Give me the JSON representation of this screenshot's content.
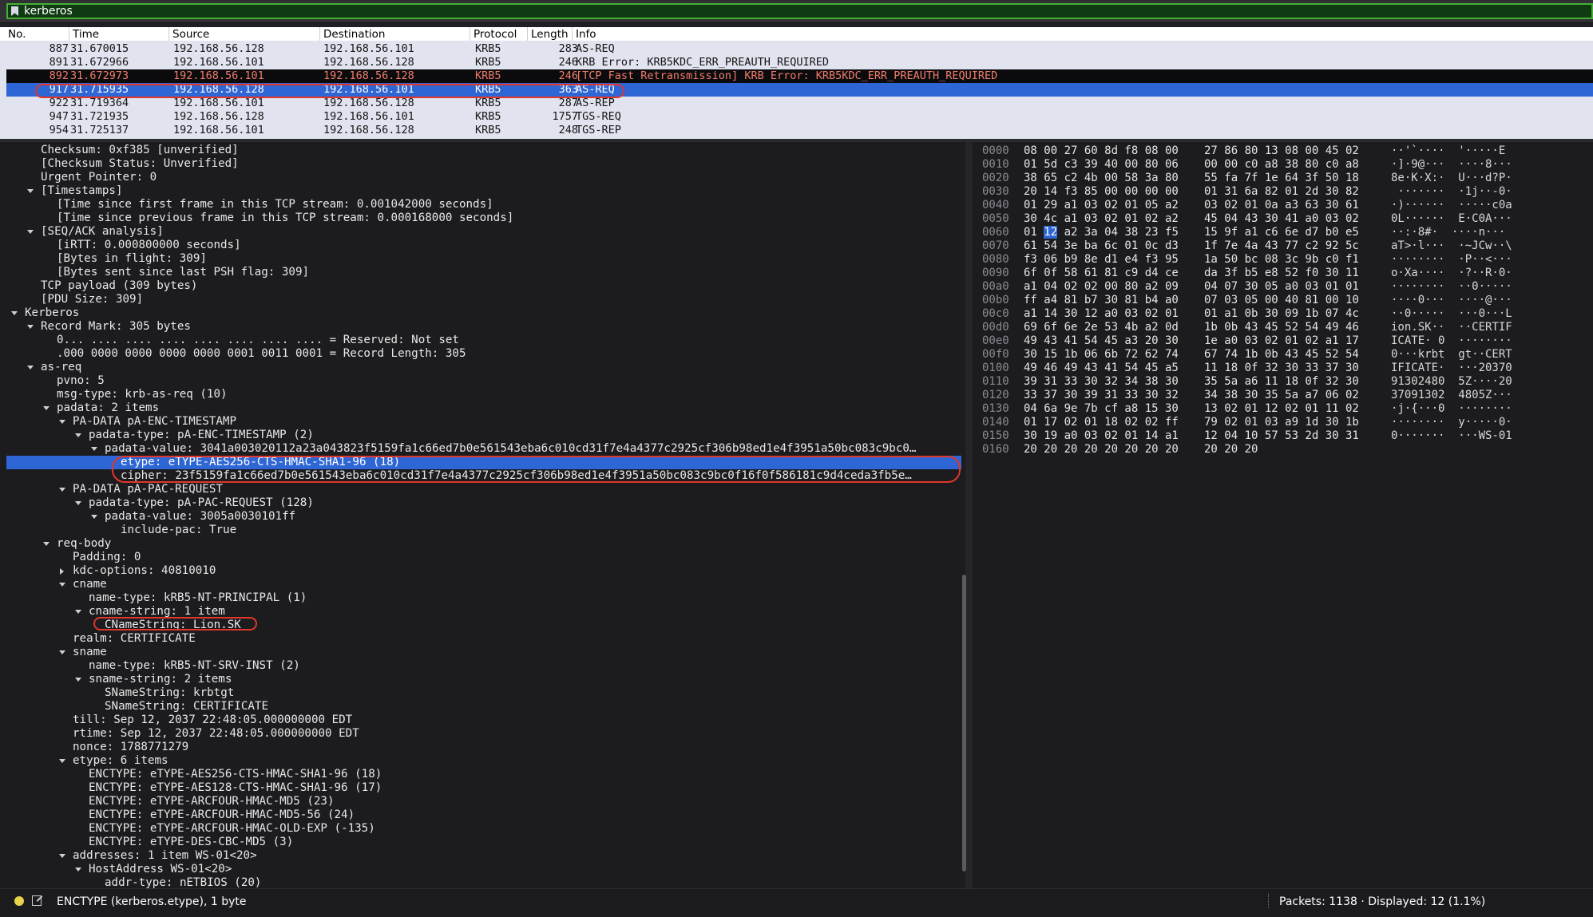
{
  "filter": {
    "value": "kerberos"
  },
  "packet_list": {
    "columns": [
      "No.",
      "Time",
      "Source",
      "Destination",
      "Protocol",
      "Length",
      "Info"
    ],
    "rows": [
      {
        "no": "887",
        "time": "31.670015",
        "src": "192.168.56.128",
        "dst": "192.168.56.101",
        "proto": "KRB5",
        "len": "283",
        "info": "AS-REQ",
        "style": "normal"
      },
      {
        "no": "891",
        "time": "31.672966",
        "src": "192.168.56.101",
        "dst": "192.168.56.128",
        "proto": "KRB5",
        "len": "246",
        "info": "KRB Error: KRB5KDC_ERR_PREAUTH_REQUIRED",
        "style": "normal"
      },
      {
        "no": "892",
        "time": "31.672973",
        "src": "192.168.56.101",
        "dst": "192.168.56.128",
        "proto": "KRB5",
        "len": "246",
        "info": "[TCP Fast Retransmission] KRB Error: KRB5KDC_ERR_PREAUTH_REQUIRED",
        "style": "bad"
      },
      {
        "no": "917",
        "time": "31.715935",
        "src": "192.168.56.128",
        "dst": "192.168.56.101",
        "proto": "KRB5",
        "len": "363",
        "info": "AS-REQ",
        "style": "selected"
      },
      {
        "no": "922",
        "time": "31.719364",
        "src": "192.168.56.101",
        "dst": "192.168.56.128",
        "proto": "KRB5",
        "len": "287",
        "info": "AS-REP",
        "style": "normal"
      },
      {
        "no": "947",
        "time": "31.721935",
        "src": "192.168.56.128",
        "dst": "192.168.56.101",
        "proto": "KRB5",
        "len": "1757",
        "info": "TGS-REQ",
        "style": "normal"
      },
      {
        "no": "954",
        "time": "31.725137",
        "src": "192.168.56.101",
        "dst": "192.168.56.128",
        "proto": "KRB5",
        "len": "248",
        "info": "TGS-REP",
        "style": "normal"
      }
    ]
  },
  "details": {
    "lines": [
      {
        "indent": 2,
        "arrow": "",
        "text": "Checksum: 0xf385 [unverified]"
      },
      {
        "indent": 2,
        "arrow": "",
        "text": "[Checksum Status: Unverified]"
      },
      {
        "indent": 2,
        "arrow": "",
        "text": "Urgent Pointer: 0"
      },
      {
        "indent": 2,
        "arrow": "down",
        "text": "[Timestamps]"
      },
      {
        "indent": 3,
        "arrow": "",
        "text": "[Time since first frame in this TCP stream: 0.001042000 seconds]"
      },
      {
        "indent": 3,
        "arrow": "",
        "text": "[Time since previous frame in this TCP stream: 0.000168000 seconds]"
      },
      {
        "indent": 2,
        "arrow": "down",
        "text": "[SEQ/ACK analysis]"
      },
      {
        "indent": 3,
        "arrow": "",
        "text": "[iRTT: 0.000800000 seconds]"
      },
      {
        "indent": 3,
        "arrow": "",
        "text": "[Bytes in flight: 309]"
      },
      {
        "indent": 3,
        "arrow": "",
        "text": "[Bytes sent since last PSH flag: 309]"
      },
      {
        "indent": 2,
        "arrow": "",
        "text": "TCP payload (309 bytes)"
      },
      {
        "indent": 2,
        "arrow": "",
        "text": "[PDU Size: 309]"
      },
      {
        "indent": 1,
        "arrow": "down",
        "text": "Kerberos"
      },
      {
        "indent": 2,
        "arrow": "down",
        "text": "Record Mark: 305 bytes"
      },
      {
        "indent": 3,
        "arrow": "",
        "text": "0... .... .... .... .... .... .... .... = Reserved: Not set"
      },
      {
        "indent": 3,
        "arrow": "",
        "text": ".000 0000 0000 0000 0000 0001 0011 0001 = Record Length: 305"
      },
      {
        "indent": 2,
        "arrow": "down",
        "text": "as-req"
      },
      {
        "indent": 3,
        "arrow": "",
        "text": "pvno: 5"
      },
      {
        "indent": 3,
        "arrow": "",
        "text": "msg-type: krb-as-req (10)"
      },
      {
        "indent": 3,
        "arrow": "down",
        "text": "padata: 2 items"
      },
      {
        "indent": 4,
        "arrow": "down",
        "text": "PA-DATA pA-ENC-TIMESTAMP"
      },
      {
        "indent": 5,
        "arrow": "down",
        "text": "padata-type: pA-ENC-TIMESTAMP (2)"
      },
      {
        "indent": 6,
        "arrow": "down",
        "text": "padata-value: 3041a003020112a23a043823f5159fa1c66ed7b0e561543eba6c010cd31f7e4a4377c2925cf306b98ed1e4f3951a50bc083c9bc0…"
      },
      {
        "indent": 7,
        "arrow": "",
        "text": "etype: eTYPE-AES256-CTS-HMAC-SHA1-96 (18)",
        "selected": true
      },
      {
        "indent": 7,
        "arrow": "",
        "text": "cipher: 23f5159fa1c66ed7b0e561543eba6c010cd31f7e4a4377c2925cf306b98ed1e4f3951a50bc083c9bc0f16f0f586181c9d4ceda3fb5e…"
      },
      {
        "indent": 4,
        "arrow": "down",
        "text": "PA-DATA pA-PAC-REQUEST"
      },
      {
        "indent": 5,
        "arrow": "down",
        "text": "padata-type: pA-PAC-REQUEST (128)"
      },
      {
        "indent": 6,
        "arrow": "down",
        "text": "padata-value: 3005a0030101ff"
      },
      {
        "indent": 7,
        "arrow": "",
        "text": "include-pac: True"
      },
      {
        "indent": 3,
        "arrow": "down",
        "text": "req-body"
      },
      {
        "indent": 4,
        "arrow": "",
        "text": "Padding: 0"
      },
      {
        "indent": 4,
        "arrow": "right",
        "text": "kdc-options: 40810010"
      },
      {
        "indent": 4,
        "arrow": "down",
        "text": "cname"
      },
      {
        "indent": 5,
        "arrow": "",
        "text": "name-type: kRB5-NT-PRINCIPAL (1)"
      },
      {
        "indent": 5,
        "arrow": "down",
        "text": "cname-string: 1 item"
      },
      {
        "indent": 6,
        "arrow": "",
        "text": "CNameString: Lion.SK"
      },
      {
        "indent": 4,
        "arrow": "",
        "text": "realm: CERTIFICATE"
      },
      {
        "indent": 4,
        "arrow": "down",
        "text": "sname"
      },
      {
        "indent": 5,
        "arrow": "",
        "text": "name-type: kRB5-NT-SRV-INST (2)"
      },
      {
        "indent": 5,
        "arrow": "down",
        "text": "sname-string: 2 items"
      },
      {
        "indent": 6,
        "arrow": "",
        "text": "SNameString: krbtgt"
      },
      {
        "indent": 6,
        "arrow": "",
        "text": "SNameString: CERTIFICATE"
      },
      {
        "indent": 4,
        "arrow": "",
        "text": "till: Sep 12, 2037 22:48:05.000000000 EDT"
      },
      {
        "indent": 4,
        "arrow": "",
        "text": "rtime: Sep 12, 2037 22:48:05.000000000 EDT"
      },
      {
        "indent": 4,
        "arrow": "",
        "text": "nonce: 1788771279"
      },
      {
        "indent": 4,
        "arrow": "down",
        "text": "etype: 6 items"
      },
      {
        "indent": 5,
        "arrow": "",
        "text": "ENCTYPE: eTYPE-AES256-CTS-HMAC-SHA1-96 (18)"
      },
      {
        "indent": 5,
        "arrow": "",
        "text": "ENCTYPE: eTYPE-AES128-CTS-HMAC-SHA1-96 (17)"
      },
      {
        "indent": 5,
        "arrow": "",
        "text": "ENCTYPE: eTYPE-ARCFOUR-HMAC-MD5 (23)"
      },
      {
        "indent": 5,
        "arrow": "",
        "text": "ENCTYPE: eTYPE-ARCFOUR-HMAC-MD5-56 (24)"
      },
      {
        "indent": 5,
        "arrow": "",
        "text": "ENCTYPE: eTYPE-ARCFOUR-HMAC-OLD-EXP (-135)"
      },
      {
        "indent": 5,
        "arrow": "",
        "text": "ENCTYPE: eTYPE-DES-CBC-MD5 (3)"
      },
      {
        "indent": 4,
        "arrow": "down",
        "text": "addresses: 1 item WS-01<20>"
      },
      {
        "indent": 5,
        "arrow": "down",
        "text": "HostAddress WS-01<20>"
      },
      {
        "indent": 6,
        "arrow": "",
        "text": "addr-type: nETBIOS (20)"
      }
    ]
  },
  "bytes": {
    "rows": [
      {
        "off": "0000",
        "hex1": "08 00 27 60 8d f8 08 00",
        "hex2": "27 86 80 13 08 00 45 02",
        "ascii": "··'`····  '·····E"
      },
      {
        "off": "0010",
        "hex1": "01 5d c3 39 40 00 80 06",
        "hex2": "00 00 c0 a8 38 80 c0 a8",
        "ascii": "·]·9@···  ····8···"
      },
      {
        "off": "0020",
        "hex1": "38 65 c2 4b 00 58 3a 80",
        "hex2": "55 fa 7f 1e 64 3f 50 18",
        "ascii": "8e·K·X:·  U···d?P·"
      },
      {
        "off": "0030",
        "hex1": "20 14 f3 85 00 00 00 00",
        "hex2": "01 31 6a 82 01 2d 30 82",
        "ascii": " ·······  ·1j··-0·"
      },
      {
        "off": "0040",
        "hex1": "01 29 a1 03 02 01 05 a2",
        "hex2": "03 02 01 0a a3 63 30 61",
        "ascii": "·)······  ·····c0a"
      },
      {
        "off": "0050",
        "hex1": "30 4c a1 03 02 01 02 a2",
        "hex2": "45 04 43 30 41 a0 03 02",
        "ascii": "0L······  E·C0A···"
      },
      {
        "off": "0060",
        "hex1": "01 12 a2 3a 04 38 23 f5",
        "hex2": "15 9f a1 c6 6e d7 b0 e5",
        "ascii": "··:·8#·  ····n···"
      },
      {
        "off": "0070",
        "hex1": "61 54 3e ba 6c 01 0c d3",
        "hex2": "1f 7e 4a 43 77 c2 92 5c",
        "ascii": "aT>·l···  ·~JCw··\\"
      },
      {
        "off": "0080",
        "hex1": "f3 06 b9 8e d1 e4 f3 95",
        "hex2": "1a 50 bc 08 3c 9b c0 f1",
        "ascii": "········  ·P··<···"
      },
      {
        "off": "0090",
        "hex1": "6f 0f 58 61 81 c9 d4 ce",
        "hex2": "da 3f b5 e8 52 f0 30 11",
        "ascii": "o·Xa····  ·?··R·0·"
      },
      {
        "off": "00a0",
        "hex1": "a1 04 02 02 00 80 a2 09",
        "hex2": "04 07 30 05 a0 03 01 01",
        "ascii": "········  ··0·····"
      },
      {
        "off": "00b0",
        "hex1": "ff a4 81 b7 30 81 b4 a0",
        "hex2": "07 03 05 00 40 81 00 10",
        "ascii": "····0···  ····@···"
      },
      {
        "off": "00c0",
        "hex1": "a1 14 30 12 a0 03 02 01",
        "hex2": "01 a1 0b 30 09 1b 07 4c",
        "ascii": "··0·····  ···0···L"
      },
      {
        "off": "00d0",
        "hex1": "69 6f 6e 2e 53 4b a2 0d",
        "hex2": "1b 0b 43 45 52 54 49 46",
        "ascii": "ion.SK··  ··CERTIF"
      },
      {
        "off": "00e0",
        "hex1": "49 43 41 54 45 a3 20 30",
        "hex2": "1e a0 03 02 01 02 a1 17",
        "ascii": "ICATE· 0  ········"
      },
      {
        "off": "00f0",
        "hex1": "30 15 1b 06 6b 72 62 74",
        "hex2": "67 74 1b 0b 43 45 52 54",
        "ascii": "0···krbt  gt··CERT"
      },
      {
        "off": "0100",
        "hex1": "49 46 49 43 41 54 45 a5",
        "hex2": "11 18 0f 32 30 33 37 30",
        "ascii": "IFICATE·  ···20370"
      },
      {
        "off": "0110",
        "hex1": "39 31 33 30 32 34 38 30",
        "hex2": "35 5a a6 11 18 0f 32 30",
        "ascii": "91302480  5Z····20"
      },
      {
        "off": "0120",
        "hex1": "33 37 30 39 31 33 30 32",
        "hex2": "34 38 30 35 5a a7 06 02",
        "ascii": "37091302  4805Z···"
      },
      {
        "off": "0130",
        "hex1": "04 6a 9e 7b cf a8 15 30",
        "hex2": "13 02 01 12 02 01 11 02",
        "ascii": "·j·{···0  ········"
      },
      {
        "off": "0140",
        "hex1": "01 17 02 01 18 02 02 ff",
        "hex2": "79 02 01 03 a9 1d 30 1b",
        "ascii": "········  y·····0·"
      },
      {
        "off": "0150",
        "hex1": "30 19 a0 03 02 01 14 a1",
        "hex2": "12 04 10 57 53 2d 30 31",
        "ascii": "0·······  ···WS-01"
      },
      {
        "off": "0160",
        "hex1": "20 20 20 20 20 20 20 20",
        "hex2": "20 20 20",
        "ascii": ""
      }
    ],
    "highlight_byte": "12"
  },
  "status": {
    "field": "ENCTYPE (kerberos.etype), 1 byte",
    "packets": "Packets: 1138 · Displayed: 12 (1.1%)"
  },
  "colors": {
    "selected": "#2f66d5",
    "annotation": "#e0362c",
    "filter_valid": "#46b035"
  }
}
